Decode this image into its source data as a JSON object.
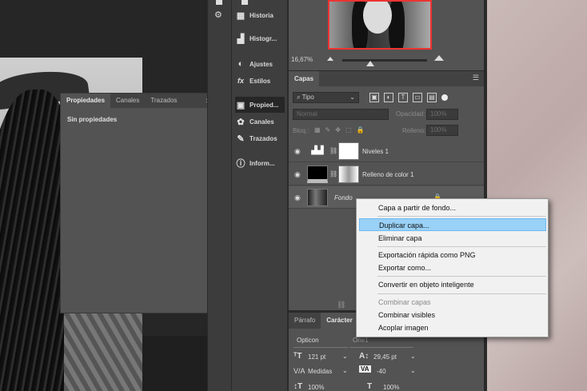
{
  "properties_panel": {
    "tabs": [
      "Propiedades",
      "Canales",
      "Trazados"
    ],
    "menu_glyphs": ">>",
    "empty_text": "Sin propiedades"
  },
  "dock": {
    "items": [
      {
        "label": "Historia",
        "icon": "history-icon"
      },
      {
        "label": "Histogr...",
        "icon": "histogram-icon"
      },
      {
        "label": "Ajustes",
        "icon": "adjustments-icon"
      },
      {
        "label": "Estilos",
        "icon": "styles-icon"
      },
      {
        "label": "Propied...",
        "icon": "properties-icon",
        "selected": true
      },
      {
        "label": "Canales",
        "icon": "channels-icon"
      },
      {
        "label": "Trazados",
        "icon": "paths-icon"
      },
      {
        "label": "Inform...",
        "icon": "info-icon"
      }
    ]
  },
  "navigator": {
    "zoom": "16,67%",
    "zoom_level": 0.33
  },
  "layers_panel": {
    "tab": "Capas",
    "filter_kind": "Tipo",
    "blend_mode": "Normal",
    "opacity_label": "Opacidad:",
    "opacity_value": "100%",
    "lock_label": "Bloq.:",
    "fill_label": "Relleno:",
    "fill_value": "100%",
    "layers": [
      {
        "name": "Niveles 1"
      },
      {
        "name": "Relleno de color 1"
      },
      {
        "name": "Fondo"
      }
    ]
  },
  "character_panel": {
    "tabs": [
      "Párrafo",
      "Carácter"
    ],
    "font_family": "Opticon",
    "font_style": "One1",
    "font_size": "121 pt",
    "leading": "29,45 pt",
    "kerning": "Medidas",
    "tracking": "-40",
    "vertical_scale": "100%",
    "horizontal_scale": "100%"
  },
  "context_menu": {
    "items": [
      {
        "label": "Capa a partir de fondo..."
      },
      {
        "label": "Duplicar capa...",
        "highlighted": true
      },
      {
        "label": "Eliminar capa"
      },
      {
        "label": "Exportación rápida como PNG"
      },
      {
        "label": "Exportar como..."
      },
      {
        "label": "Convertir en objeto inteligente"
      },
      {
        "label": "Combinar capas",
        "disabled": true
      },
      {
        "label": "Combinar visibles"
      },
      {
        "label": "Acoplar imagen"
      }
    ]
  },
  "colors": {
    "highlight": "#99d1f7",
    "panel": "#535353",
    "thumb_border": "#ee3333"
  }
}
